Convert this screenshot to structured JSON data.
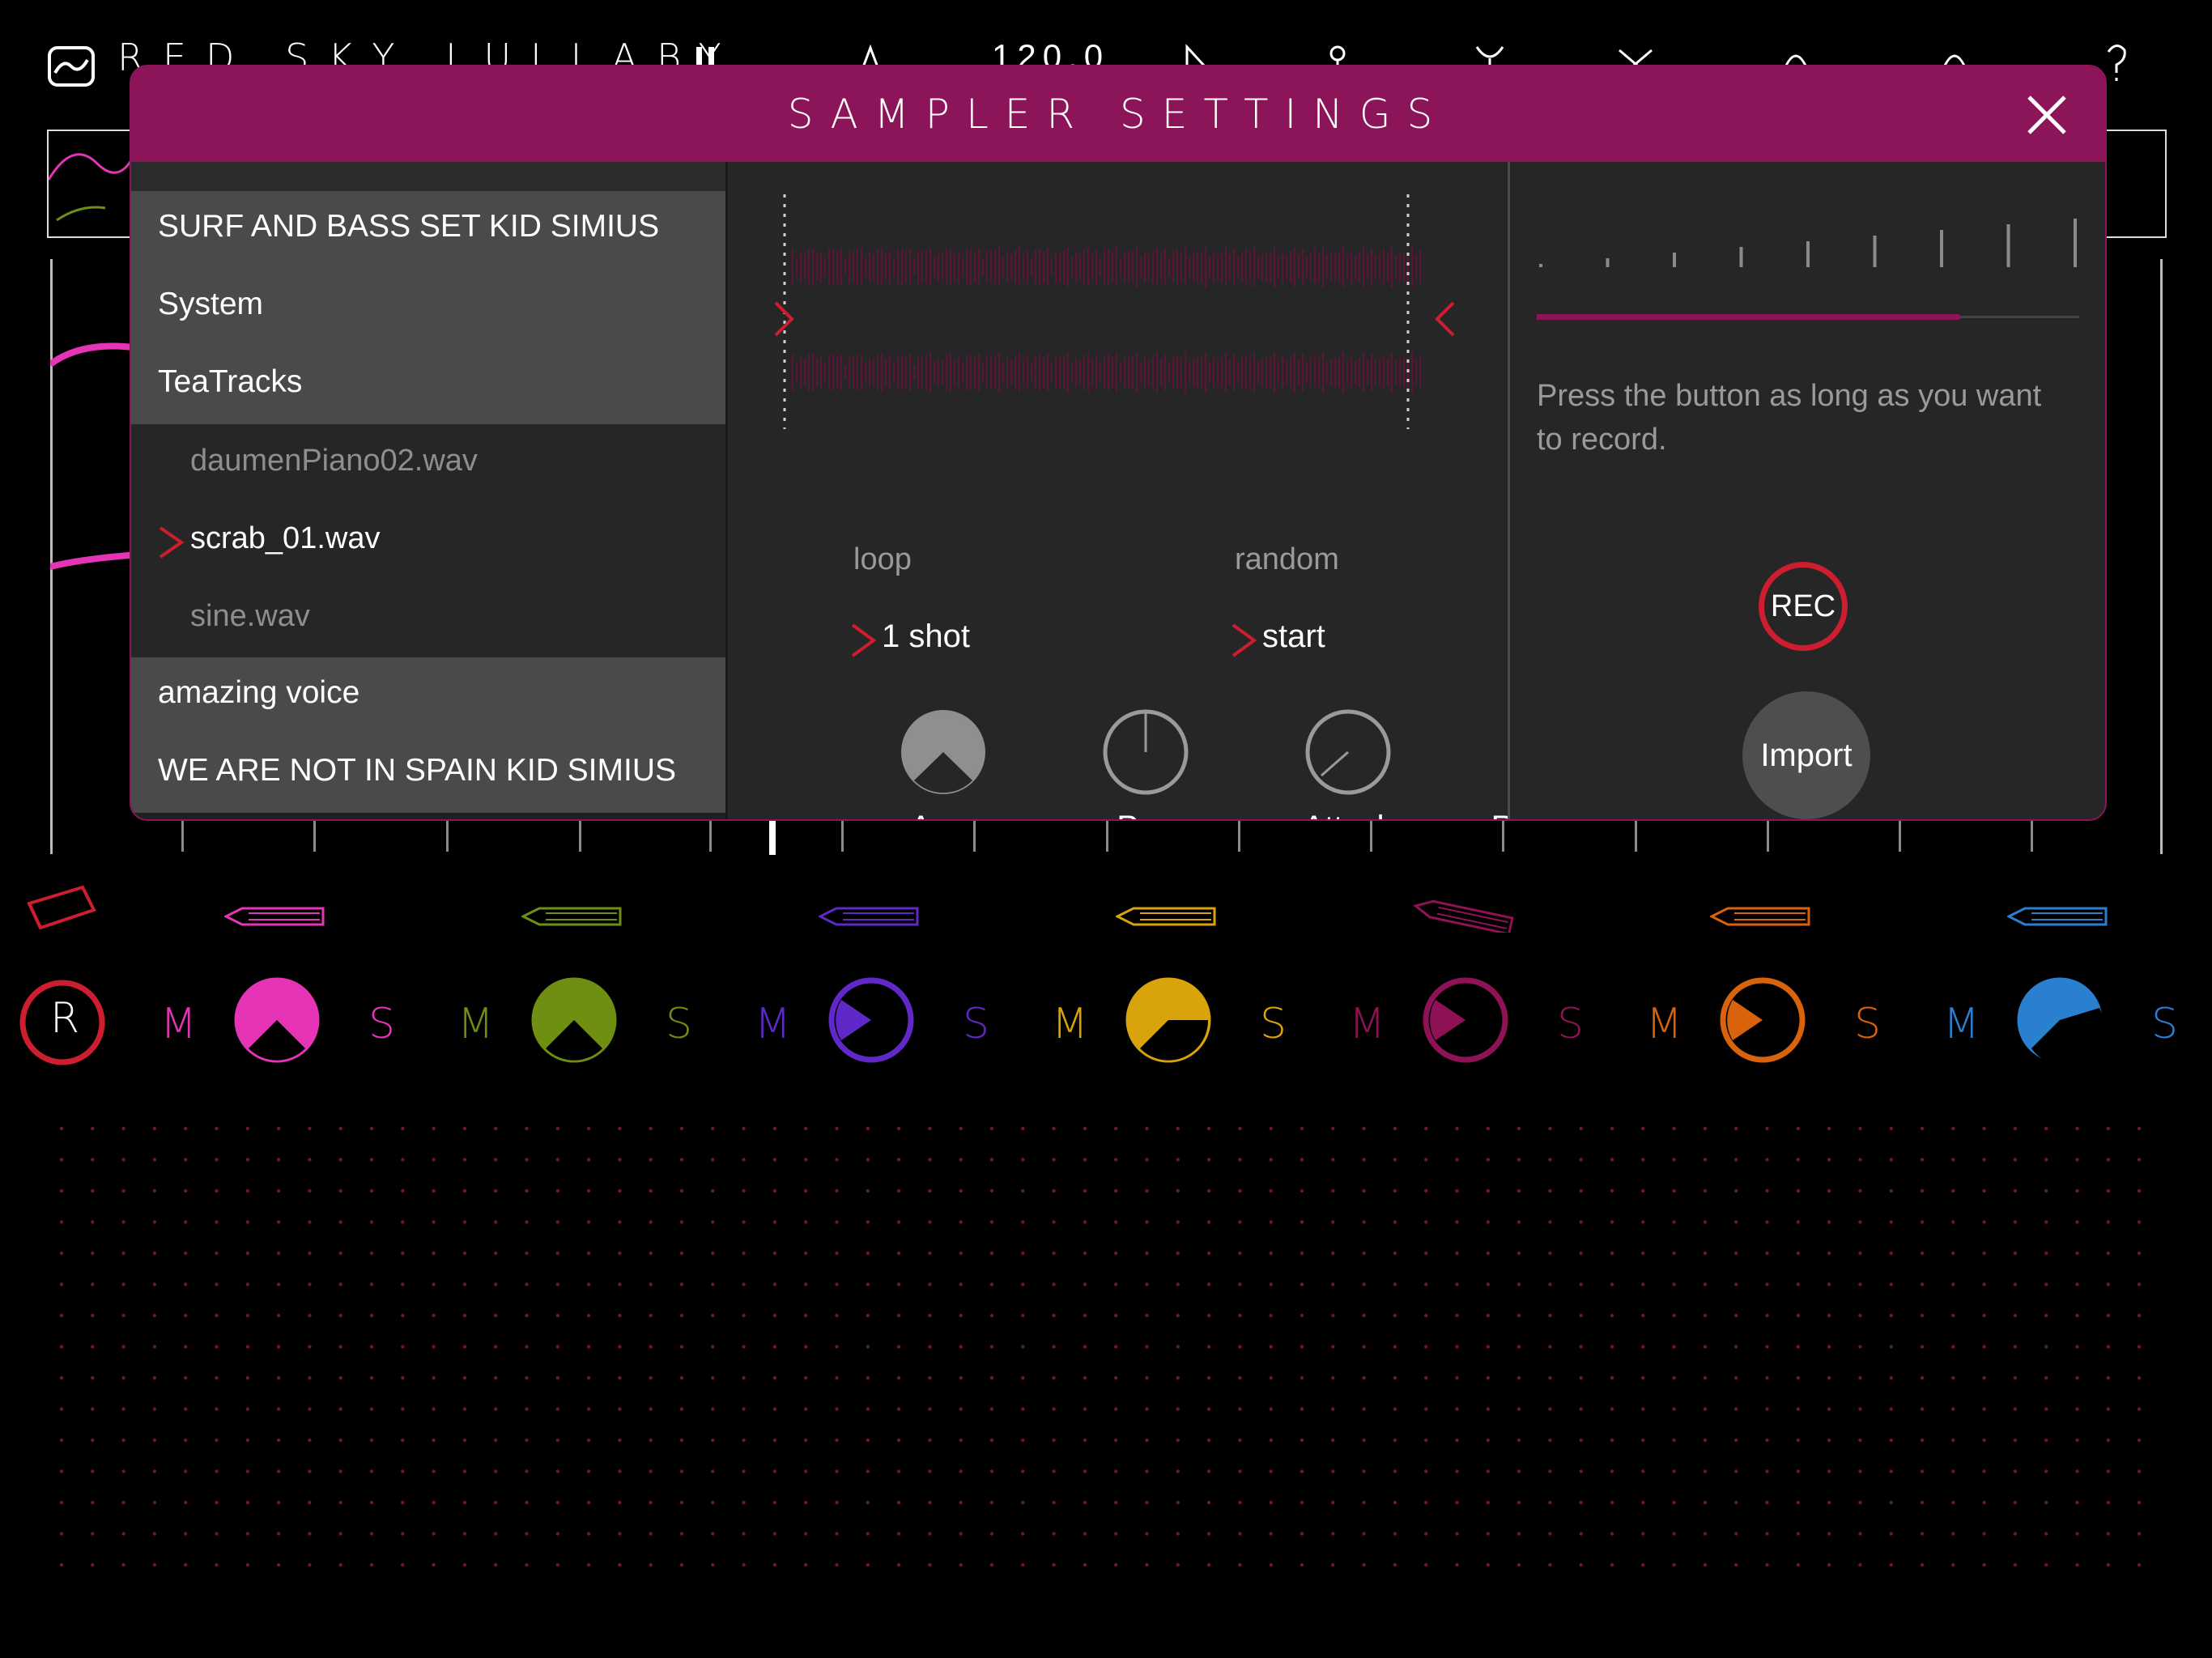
{
  "app": {
    "song_title": "RED SKY LULLABY",
    "tempo": "120.0"
  },
  "modal": {
    "title": "SAMPLER SETTINGS",
    "accent_color": "#8c1559"
  },
  "browser": {
    "folders_top": [
      "SURF AND BASS SET KID SIMIUS",
      "System",
      "TeaTracks"
    ],
    "files": [
      {
        "name": "daumenPiano02.wav",
        "selected": false
      },
      {
        "name": "scrab_01.wav",
        "selected": true
      },
      {
        "name": "sine.wav",
        "selected": false
      }
    ],
    "folders_bottom": [
      "amazing voice",
      "WE ARE NOT IN SPAIN KID SIMIUS"
    ]
  },
  "options": {
    "loop_label": "loop",
    "loop_value": "1 shot",
    "random_label": "random",
    "random_value": "start"
  },
  "knobs": [
    {
      "label": "Amp"
    },
    {
      "label": "Pan"
    },
    {
      "label": "Attack"
    },
    {
      "label": "Release"
    }
  ],
  "record": {
    "hint": "Press the button as long as you want to record.",
    "rec_label": "REC",
    "import_label": "Import",
    "level_fraction": 0.78
  },
  "tracks": {
    "record_letter": "R",
    "mute_letter": "M",
    "solo_letter": "S",
    "colors": [
      "#e535b6",
      "#6e8f12",
      "#6128c9",
      "#d9a30c",
      "#8f1257",
      "#d9620c",
      "#2a7fd0"
    ]
  }
}
